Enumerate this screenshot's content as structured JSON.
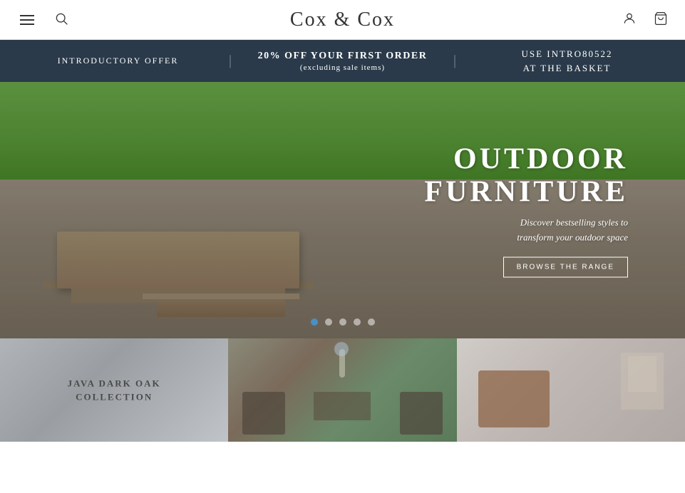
{
  "header": {
    "logo": "Cox & Cox",
    "menu_icon": "menu",
    "search_icon": "search",
    "account_icon": "user",
    "cart_icon": "shopping-bag"
  },
  "promo_bar": {
    "intro_label": "INTRODUCTORY OFFER",
    "divider1": "|",
    "offer_main": "20% OFF YOUR FIRST ORDER",
    "offer_sub": "(excluding sale items)",
    "divider2": "|",
    "code_line1": "USE INTRO80522",
    "code_line2": "AT THE BASKET"
  },
  "hero": {
    "title_line1": "OUTDOOR",
    "title_line2": "FURNITURE",
    "description_line1": "Discover bestselling styles to",
    "description_line2": "transform your outdoor space",
    "cta_label": "BROWSE THE RANGE",
    "dots": [
      {
        "active": true
      },
      {
        "active": false
      },
      {
        "active": false
      },
      {
        "active": false
      },
      {
        "active": false
      }
    ]
  },
  "product_cards": [
    {
      "id": "java-dark-oak",
      "label_line1": "JAVA DARK OAK",
      "label_line2": "COLLECTION",
      "bg_class": "card-bg-1"
    },
    {
      "id": "outdoor-dining",
      "label_line1": "",
      "label_line2": "",
      "bg_class": "card-bg-2"
    },
    {
      "id": "living-room",
      "label_line1": "",
      "label_line2": "",
      "bg_class": "card-bg-3"
    }
  ]
}
